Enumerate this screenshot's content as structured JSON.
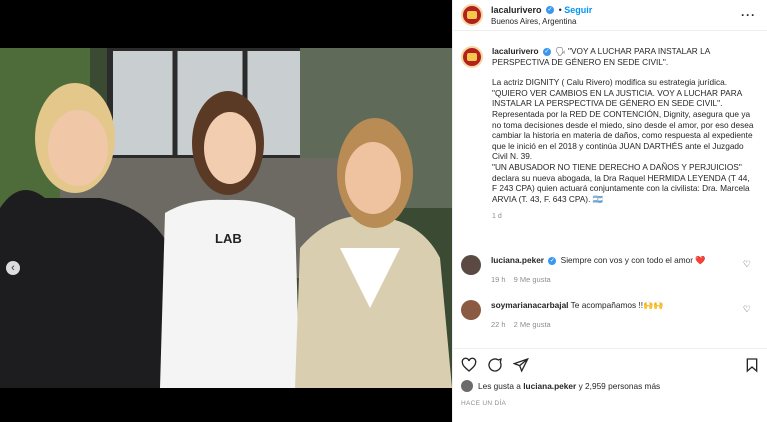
{
  "post": {
    "username": "lacalurivero",
    "follow_label": "Seguir",
    "location": "Buenos Aires, Argentina",
    "more_label": "···",
    "caption_lines": [
      "🗣 \"VOY A LUCHAR PARA INSTALAR LA PERSPECTIVA DE GÉNERO EN SEDE CIVIL\".",
      "",
      "La actriz DIGNITY ( Calu Rivero) modifica su estrategia jurídica.",
      "\"QUIERO VER CAMBIOS EN LA JUSTICIA. VOY A LUCHAR PARA INSTALAR LA PERSPECTIVA DE GÉNERO EN SEDE CIVIL\".",
      "Representada por la RED DE CONTENCIÓN, Dignity, asegura que ya no toma decisiones desde el miedo, sino desde el amor, por eso desea cambiar la historia en materia de daños, como respuesta al expediente que le inició en el 2018 y continúa JUAN DARTHÉS ante el Juzgado Civil N. 39.",
      "\"UN ABUSADOR NO TIENE DERECHO A DAÑOS Y PERJUICIOS\" declara su nueva abogada, la Dra Raquel HERMIDA LEYENDA (T 44, F 243 CPA) quien actuará conjuntamente con la civilista: Dra. Marcela ARVIA (T. 43, F. 643 CPA). 🇦🇷"
    ],
    "caption_age": "1 d",
    "badge_text": "LAB"
  },
  "comments": [
    {
      "user": "luciana.peker",
      "text": "Siempre con vos y con todo el amor ❤️",
      "age": "19 h",
      "likes": "9 Me gusta"
    },
    {
      "user": "soymarianacarbajal",
      "text": "Te acompañamos !!🙌🙌",
      "age": "22 h",
      "likes": "2 Me gusta"
    }
  ],
  "likes": {
    "prefix": "Les gusta a ",
    "user": "luciana.peker",
    "suffix": " y 2,959 personas más"
  },
  "date": "HACE UN DÍA",
  "colors": {
    "link": "#0095f6",
    "verified": "#3897f0",
    "muted": "#8e8e8e"
  }
}
